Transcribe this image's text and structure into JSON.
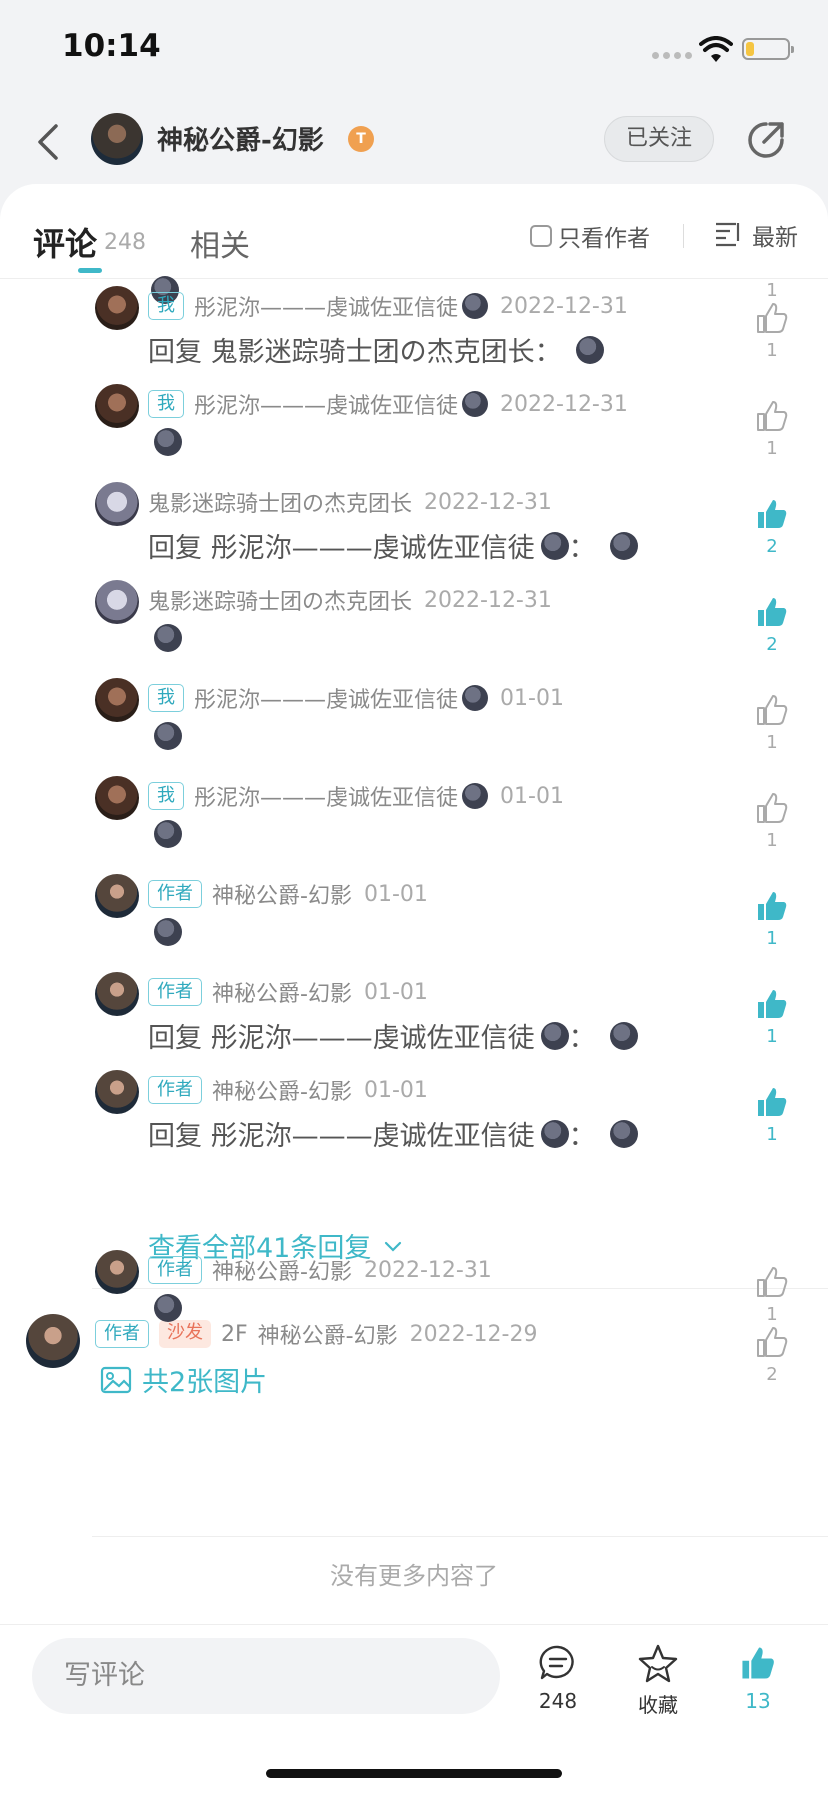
{
  "status": {
    "time": "10:14",
    "battery_level": 0.2
  },
  "header": {
    "name": "神秘公爵-幻影",
    "level": "T",
    "follow_label": "已关注"
  },
  "tabs": {
    "comments_label": "评论",
    "comments_count": "248",
    "related_label": "相关",
    "author_only_label": "只看作者",
    "sort_label": "最新"
  },
  "top_partial": {
    "like_count": "1"
  },
  "replies": [
    {
      "tag": "我",
      "user": "彤泥沵———虔诚佐亚信徒",
      "date": "2022-12-31",
      "content": "回复 鬼影迷踪骑士团の杰克团长：",
      "likes": "1",
      "liked": false
    },
    {
      "tag": "我",
      "user": "彤泥沵———虔诚佐亚信徒",
      "date": "2022-12-31",
      "content": "",
      "likes": "1",
      "liked": false
    },
    {
      "tag": "",
      "user": "鬼影迷踪骑士团の杰克团长",
      "date": "2022-12-31",
      "content": "回复 彤泥沵———虔诚佐亚信徒",
      "likes": "2",
      "liked": true
    },
    {
      "tag": "",
      "user": "鬼影迷踪骑士团の杰克团长",
      "date": "2022-12-31",
      "content": "",
      "likes": "2",
      "liked": true
    },
    {
      "tag": "我",
      "user": "彤泥沵———虔诚佐亚信徒",
      "date": "01-01",
      "content": "",
      "likes": "1",
      "liked": false
    },
    {
      "tag": "我",
      "user": "彤泥沵———虔诚佐亚信徒",
      "date": "01-01",
      "content": "",
      "likes": "1",
      "liked": false
    },
    {
      "tag": "作者",
      "user": "神秘公爵-幻影",
      "date": "01-01",
      "content": "",
      "likes": "1",
      "liked": true
    },
    {
      "tag": "作者",
      "user": "神秘公爵-幻影",
      "date": "01-01",
      "content": "回复 彤泥沵———虔诚佐亚信徒",
      "likes": "1",
      "liked": true
    },
    {
      "tag": "作者",
      "user": "神秘公爵-幻影",
      "date": "01-01",
      "content": "回复 彤泥沵———虔诚佐亚信徒",
      "likes": "1",
      "liked": true
    }
  ],
  "view_all_label": "查看全部41条回复",
  "floor2": {
    "tag_author": "作者",
    "tag_sofa": "沙发",
    "floor": "2F",
    "user": "神秘公爵-幻影",
    "date": "2022-12-29",
    "images_label": "共2张图片",
    "likes": "2",
    "reply": {
      "tag": "作者",
      "user": "神秘公爵-幻影",
      "date": "2022-12-31",
      "likes": "1"
    }
  },
  "no_more_label": "没有更多内容了",
  "bottom": {
    "input_placeholder": "写评论",
    "comments_count": "248",
    "favorite_label": "收藏",
    "likes_count": "13"
  },
  "colors": {
    "accent": "#3fb8c8",
    "tag_sofa": "#e8735a"
  }
}
